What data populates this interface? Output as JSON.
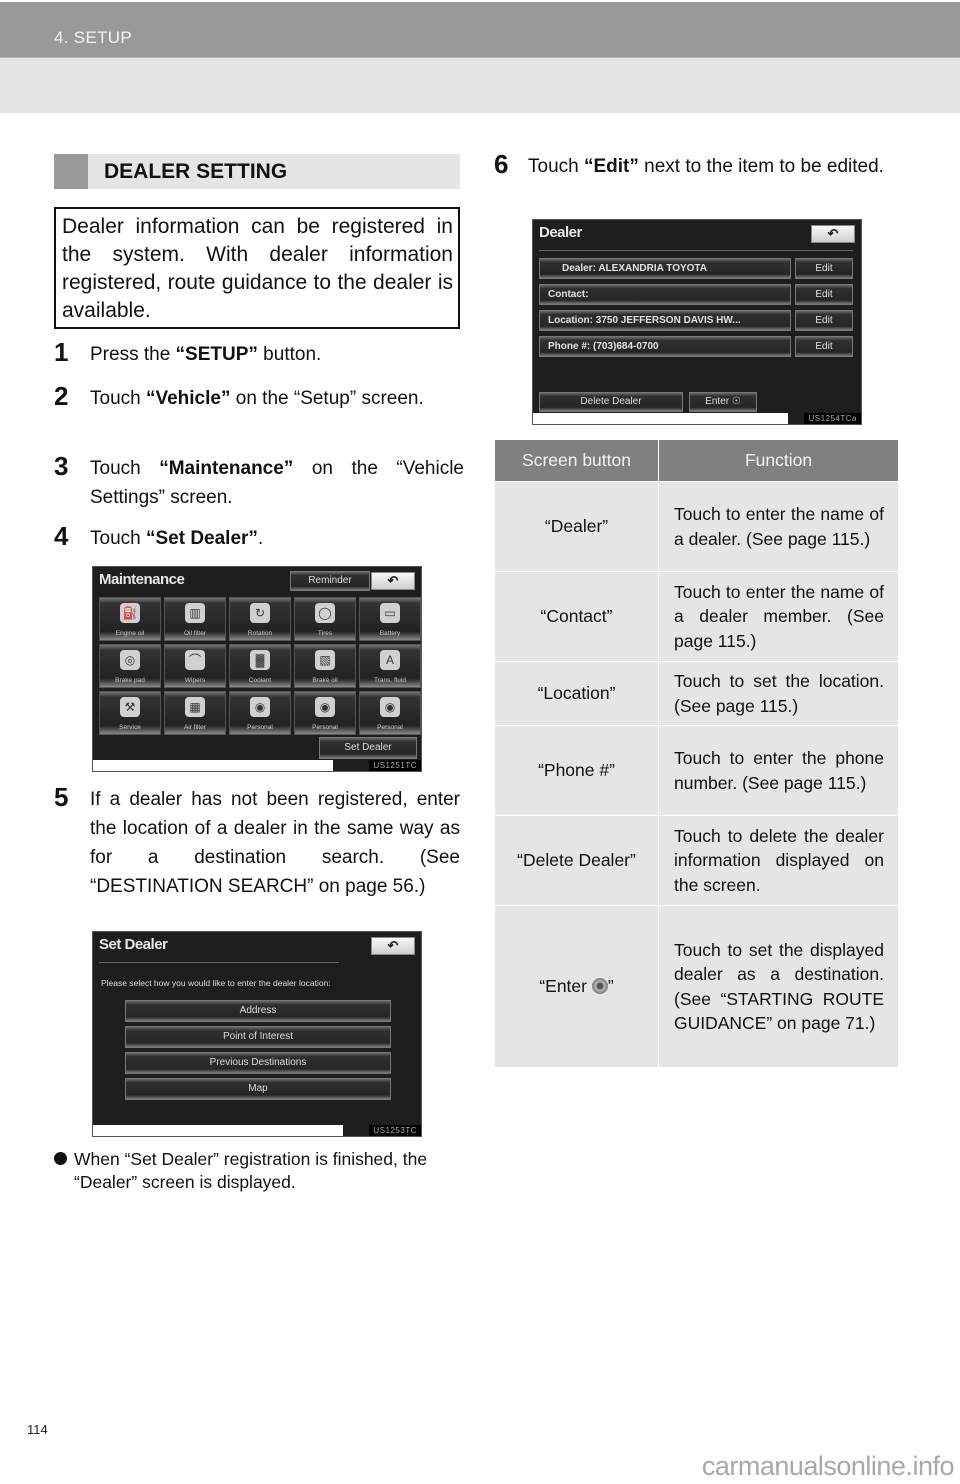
{
  "header": {
    "section": "4. SETUP"
  },
  "left": {
    "heading": "DEALER SETTING",
    "intro": "Dealer information can be registered in the system. With dealer information registered, route guidance to the dealer is available.",
    "steps": [
      {
        "num": "1",
        "pre": "Press the ",
        "bold": "“SETUP”",
        "post": " button."
      },
      {
        "num": "2",
        "pre": "Touch ",
        "bold": "“Vehicle”",
        "post": " on the “Setup” screen."
      },
      {
        "num": "3",
        "pre": "Touch ",
        "bold": "“Maintenance”",
        "post": " on the “Vehicle Settings” screen."
      },
      {
        "num": "4",
        "pre": "Touch ",
        "bold": "“Set Dealer”",
        "post": "."
      },
      {
        "num": "5",
        "pre": "If a dealer has not been registered, enter the location of a dealer in the same way as for a destination search. (See “DESTINATION SEARCH” on page 56.)",
        "bold": "",
        "post": ""
      }
    ],
    "bullet": "When “Set Dealer” registration is finished, the “Dealer” screen is displayed."
  },
  "maintenance_screen": {
    "title": "Maintenance",
    "reminder_label": "Reminder",
    "back_icon": "↶",
    "tiles": [
      {
        "label": "Engine oil",
        "icon": "oil-can"
      },
      {
        "label": "Oil filter",
        "icon": "filter"
      },
      {
        "label": "Rotation",
        "icon": "tire-rotation"
      },
      {
        "label": "Tires",
        "icon": "tire"
      },
      {
        "label": "Battery",
        "icon": "battery"
      },
      {
        "label": "Brake pad",
        "icon": "brake-disc"
      },
      {
        "label": "Wipers",
        "icon": "wiper"
      },
      {
        "label": "Coolant",
        "icon": "radiator"
      },
      {
        "label": "Brake oil",
        "icon": "brake-fluid"
      },
      {
        "label": "Trans. fluid",
        "icon": "transmission"
      },
      {
        "label": "Service",
        "icon": "wrench"
      },
      {
        "label": "Air filter",
        "icon": "air-filter"
      },
      {
        "label": "Personal",
        "icon": "personal"
      },
      {
        "label": "Personal",
        "icon": "personal"
      },
      {
        "label": "Personal",
        "icon": "personal"
      }
    ],
    "set_dealer_label": "Set Dealer",
    "caption": "US1251TC"
  },
  "set_dealer_screen": {
    "title": "Set Dealer",
    "back_icon": "↶",
    "prompt": "Please select how you would like to enter the dealer location:",
    "options": [
      "Address",
      "Point of Interest",
      "Previous Destinations",
      "Map"
    ],
    "caption": "US1253TC"
  },
  "right": {
    "step6": {
      "num": "6",
      "pre": "Touch ",
      "bold": "“Edit”",
      "post": " next to the item to be edited."
    }
  },
  "dealer_screen": {
    "title": "Dealer",
    "back_icon": "↶",
    "rows": [
      {
        "label": "Dealer:",
        "value": "ALEXANDRIA TOYOTA",
        "edit": "Edit"
      },
      {
        "label": "Contact:",
        "value": "",
        "edit": "Edit"
      },
      {
        "label": "Location:",
        "value": "3750 JEFFERSON DAVIS HW...",
        "edit": "Edit"
      },
      {
        "label": "Phone #:",
        "value": "(703)684-0700",
        "edit": "Edit"
      }
    ],
    "delete_label": "Delete Dealer",
    "enter_label": "Enter",
    "caption": "US1254TCa"
  },
  "table": {
    "headers": [
      "Screen button",
      "Function"
    ],
    "rows": [
      {
        "button": "“Dealer”",
        "function": "Touch to enter the name of a dealer. (See page 115.)"
      },
      {
        "button": "“Contact”",
        "function": "Touch to enter the name of a dealer member. (See page 115.)"
      },
      {
        "button": "“Location”",
        "function": "Touch to set the location. (See page 115.)"
      },
      {
        "button": "“Phone #”",
        "function": "Touch to enter the phone number. (See page 115.)"
      },
      {
        "button": "“Delete Dealer”",
        "function": "Touch to delete the dealer information displayed on the screen."
      },
      {
        "button_pre": "“Enter ",
        "button_post": "”",
        "function": "Touch to set the displayed dealer as a destination. (See “STARTING ROUTE GUIDANCE” on page 71.)"
      }
    ]
  },
  "footer": {
    "page_number": "114",
    "watermark": "carmanualsonline.info"
  }
}
